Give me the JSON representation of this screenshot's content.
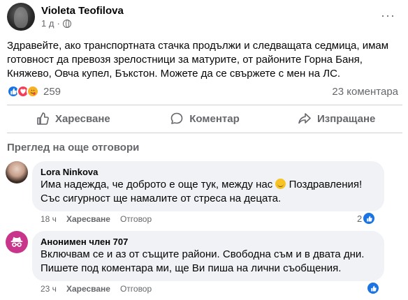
{
  "post": {
    "author": "Violeta Teofilova",
    "time": "1 д",
    "privacy_icon": "globe-icon",
    "more_label": "···",
    "text": "Здравейте, ако транспортната стачка продължи и следващата седмица, имам готовност да превозя зрелостници за матурите, от районите Горна Баня, Княжево, Овча купел, Бъкстон. Можете да се свържете с мен на ЛС.",
    "reaction_count": "259",
    "comment_count": "23 коментара"
  },
  "actions": {
    "like_label": "Харесване",
    "comment_label": "Коментар",
    "share_label": "Изпращане"
  },
  "more_replies_label": "Преглед на още отговори",
  "comments": [
    {
      "name": "Lora Ninkova",
      "text_part1": "Има надежда, че доброто е още тук, между нас ",
      "text_part2": " Поздравления! Със сигурност ще намалите от стреса на децата.",
      "time": "18 ч",
      "like_label": "Харесване",
      "reply_label": "Отговор",
      "likes": "2"
    },
    {
      "name": "Анонимен член 707",
      "text": "Включвам се и аз от същите райони. Свободна съм и в двата дни. Пишете под коментара ми, ще Ви пиша на лични съобщения.",
      "time": "23 ч",
      "like_label": "Харесване",
      "reply_label": "Отговор"
    }
  ],
  "colors": {
    "accent": "#1b74e4",
    "secondary_text": "#65676b",
    "bubble": "#f0f2f5",
    "anon_avatar": "#c9358a"
  }
}
